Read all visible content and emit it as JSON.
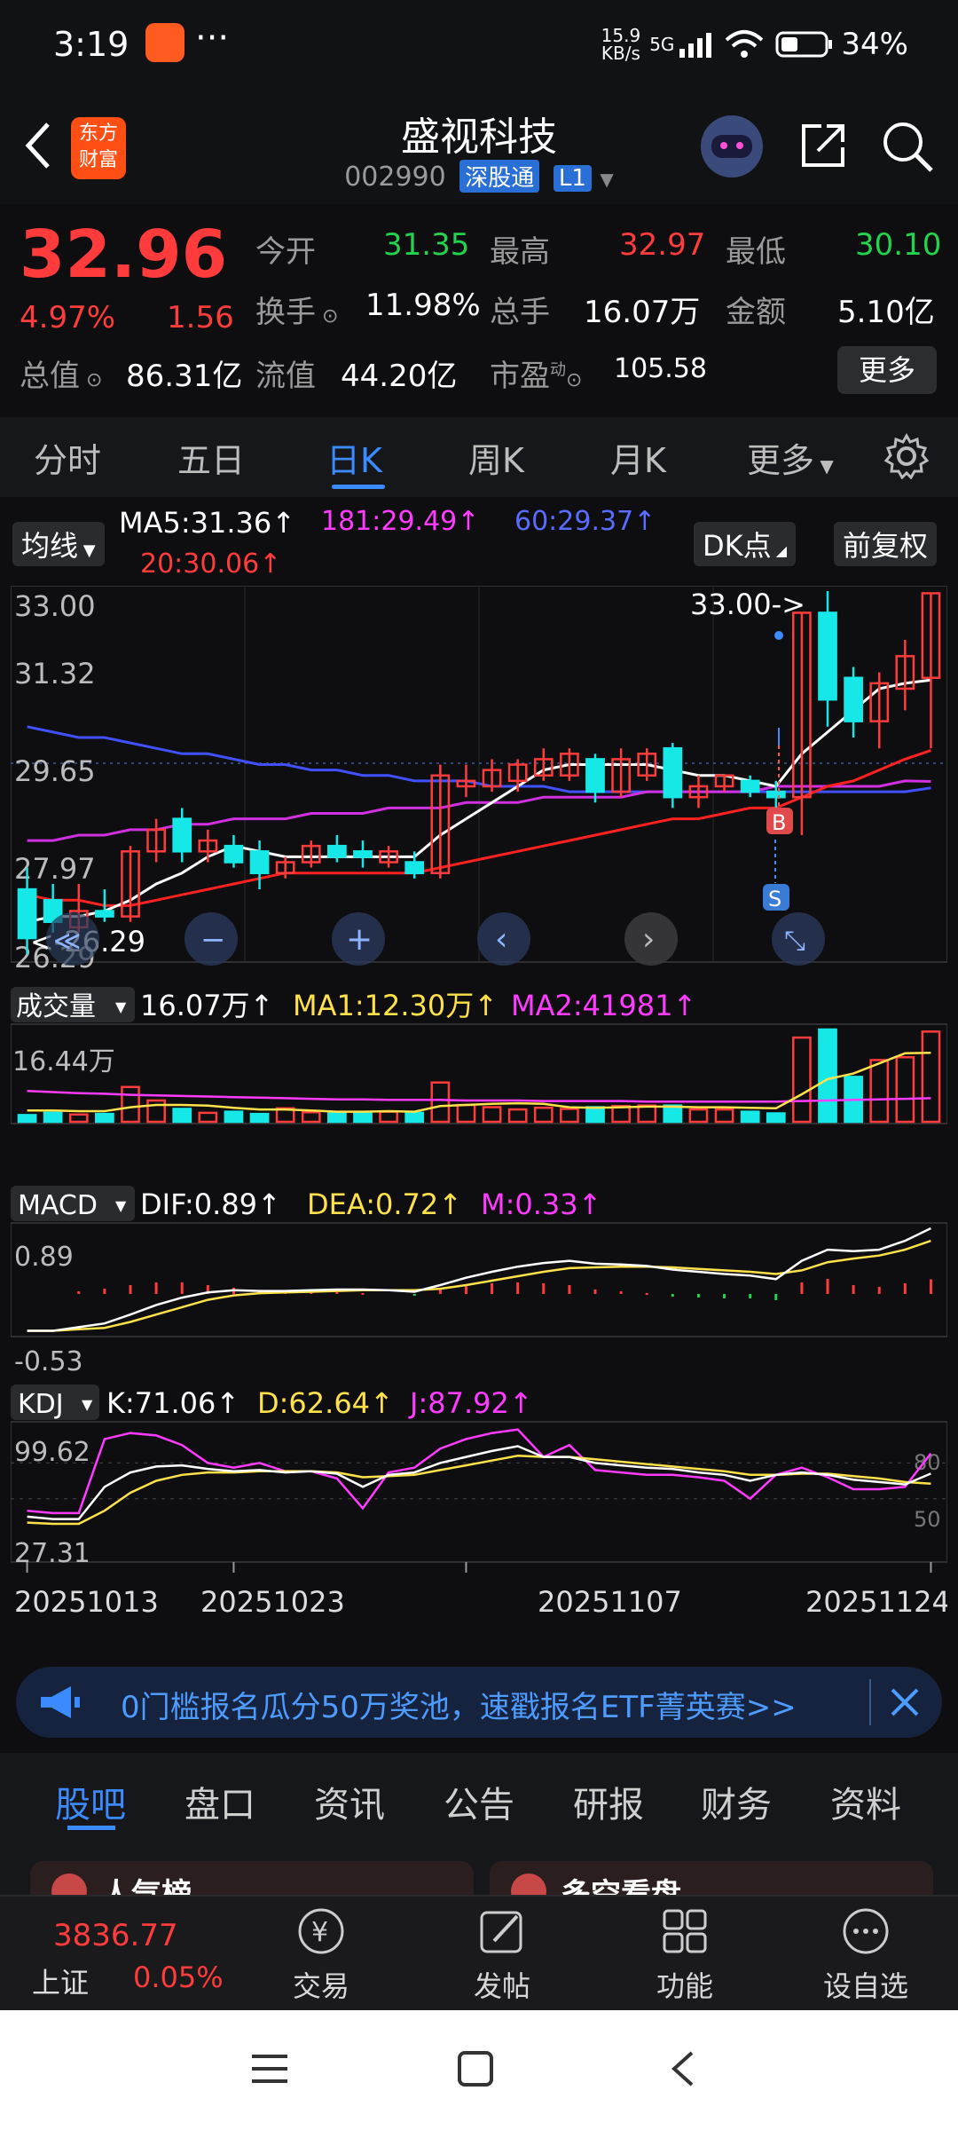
{
  "status_bar": {
    "time": "3:19",
    "net_speed_top": "15.9",
    "net_speed_bottom": "KB/s",
    "signal": "5G",
    "battery": "34%"
  },
  "header": {
    "logo_top": "东方",
    "logo_bottom": "财富",
    "title": "盛视科技",
    "code": "002990",
    "market_tag": "深股通",
    "level_tag": "L1"
  },
  "quote": {
    "price": "32.96",
    "change_pct": "4.97%",
    "change": "1.56",
    "open_label": "今开",
    "open": "31.35",
    "high_label": "最高",
    "high": "32.97",
    "low_label": "最低",
    "low": "30.10",
    "turnover_label": "换手",
    "turnover": "11.98%",
    "volume_label": "总手",
    "volume": "16.07万",
    "amount_label": "金额",
    "amount": "5.10亿",
    "mktcap_label": "总值",
    "mktcap": "86.31亿",
    "float_label": "流值",
    "float": "44.20亿",
    "pe_label": "市盈",
    "pe_sup": "动",
    "pe": "105.58",
    "more_button": "更多"
  },
  "period_tabs": [
    "分时",
    "五日",
    "日K",
    "周K",
    "月K",
    "更多"
  ],
  "active_period": "日K",
  "ma_bar": {
    "chip": "均线",
    "ma5": "MA5:31.36↑",
    "ma181": "181:29.49↑",
    "ma60": "60:29.37↑",
    "ma20": "20:30.06↑",
    "dk_button": "DK点",
    "fq_button": "前复权"
  },
  "colors": {
    "up": "#ff3b3b",
    "down": "#16e8e8",
    "ma5": "#ffffff",
    "ma20": "#ff2020",
    "ma60": "#4050ff",
    "ma181": "#d030e0",
    "accent": "#3b8bff"
  },
  "chart_data": {
    "type": "candlestick",
    "price_axis_labels": [
      "33.00",
      "31.32",
      "29.65",
      "27.97",
      "26.29"
    ],
    "ylim": [
      26.29,
      33.0
    ],
    "max_annotation": "33.00->",
    "min_annotation": "<-26.29",
    "buy_marker": "B",
    "sell_marker": "S",
    "date_labels": [
      "20251013",
      "20251023",
      "20251107",
      "20251124"
    ],
    "candles": [
      {
        "o": 27.5,
        "h": 27.9,
        "c": 26.6,
        "l": 26.3
      },
      {
        "o": 27.3,
        "h": 27.6,
        "c": 26.9,
        "l": 26.7
      },
      {
        "o": 26.8,
        "h": 27.6,
        "c": 27.1,
        "l": 26.7
      },
      {
        "o": 27.1,
        "h": 27.5,
        "c": 27.0,
        "l": 26.9
      },
      {
        "o": 27.0,
        "h": 28.3,
        "c": 28.2,
        "l": 26.9
      },
      {
        "o": 28.2,
        "h": 28.8,
        "c": 28.6,
        "l": 28.0
      },
      {
        "o": 28.8,
        "h": 29.0,
        "c": 28.2,
        "l": 28.0
      },
      {
        "o": 28.2,
        "h": 28.6,
        "c": 28.4,
        "l": 28.0
      },
      {
        "o": 28.3,
        "h": 28.5,
        "c": 28.0,
        "l": 27.9
      },
      {
        "o": 28.2,
        "h": 28.4,
        "c": 27.8,
        "l": 27.5
      },
      {
        "o": 27.8,
        "h": 28.1,
        "c": 28.0,
        "l": 27.7
      },
      {
        "o": 28.0,
        "h": 28.4,
        "c": 28.3,
        "l": 27.9
      },
      {
        "o": 28.3,
        "h": 28.5,
        "c": 28.1,
        "l": 28.0
      },
      {
        "o": 28.2,
        "h": 28.4,
        "c": 28.1,
        "l": 27.9
      },
      {
        "o": 28.0,
        "h": 28.3,
        "c": 28.2,
        "l": 27.9
      },
      {
        "o": 28.0,
        "h": 28.2,
        "c": 27.8,
        "l": 27.7
      },
      {
        "o": 27.8,
        "h": 29.8,
        "c": 29.6,
        "l": 27.7
      },
      {
        "o": 29.4,
        "h": 29.8,
        "c": 29.5,
        "l": 29.2
      },
      {
        "o": 29.4,
        "h": 29.9,
        "c": 29.7,
        "l": 29.3
      },
      {
        "o": 29.5,
        "h": 29.9,
        "c": 29.8,
        "l": 29.3
      },
      {
        "o": 29.6,
        "h": 30.1,
        "c": 29.9,
        "l": 29.5
      },
      {
        "o": 29.6,
        "h": 30.1,
        "c": 30.0,
        "l": 29.5
      },
      {
        "o": 29.9,
        "h": 30.0,
        "c": 29.3,
        "l": 29.1
      },
      {
        "o": 29.3,
        "h": 30.1,
        "c": 29.9,
        "l": 29.2
      },
      {
        "o": 29.6,
        "h": 30.1,
        "c": 30.0,
        "l": 29.5
      },
      {
        "o": 30.1,
        "h": 30.2,
        "c": 29.2,
        "l": 29.0
      },
      {
        "o": 29.2,
        "h": 29.6,
        "c": 29.4,
        "l": 29.0
      },
      {
        "o": 29.4,
        "h": 29.6,
        "c": 29.6,
        "l": 29.3
      },
      {
        "o": 29.5,
        "h": 29.6,
        "c": 29.3,
        "l": 29.2
      },
      {
        "o": 29.3,
        "h": 29.5,
        "c": 29.2,
        "l": 28.8
      },
      {
        "o": 29.2,
        "h": 32.6,
        "c": 32.6,
        "l": 28.5
      },
      {
        "o": 32.6,
        "h": 33.0,
        "c": 31.0,
        "l": 30.5
      },
      {
        "o": 31.4,
        "h": 31.6,
        "c": 30.6,
        "l": 30.3
      },
      {
        "o": 30.6,
        "h": 31.5,
        "c": 31.3,
        "l": 30.1
      },
      {
        "o": 31.2,
        "h": 32.1,
        "c": 31.8,
        "l": 30.8
      },
      {
        "o": 31.4,
        "h": 32.97,
        "c": 32.96,
        "l": 30.1
      }
    ],
    "ma5": [
      26.9,
      27.0,
      27.0,
      27.1,
      27.3,
      27.6,
      27.8,
      28.1,
      28.3,
      28.2,
      28.1,
      28.1,
      28.1,
      28.1,
      28.1,
      28.1,
      28.5,
      28.8,
      29.1,
      29.4,
      29.7,
      29.8,
      29.8,
      29.8,
      29.8,
      29.7,
      29.6,
      29.6,
      29.5,
      29.4,
      30.0,
      30.4,
      30.8,
      31.2,
      31.3,
      31.36
    ],
    "ma20": [
      27.4,
      27.3,
      27.3,
      27.2,
      27.2,
      27.3,
      27.4,
      27.5,
      27.6,
      27.7,
      27.8,
      27.8,
      27.8,
      27.8,
      27.8,
      27.8,
      27.9,
      28.0,
      28.1,
      28.2,
      28.3,
      28.4,
      28.5,
      28.6,
      28.7,
      28.8,
      28.8,
      28.9,
      29.0,
      29.0,
      29.2,
      29.4,
      29.5,
      29.7,
      29.9,
      30.06
    ],
    "ma60": [
      30.5,
      30.4,
      30.3,
      30.3,
      30.2,
      30.1,
      30.0,
      30.0,
      29.9,
      29.8,
      29.8,
      29.7,
      29.7,
      29.6,
      29.6,
      29.5,
      29.5,
      29.5,
      29.4,
      29.4,
      29.4,
      29.3,
      29.3,
      29.3,
      29.3,
      29.3,
      29.3,
      29.3,
      29.3,
      29.3,
      29.3,
      29.3,
      29.3,
      29.3,
      29.3,
      29.37
    ],
    "ma181": [
      28.4,
      28.4,
      28.5,
      28.5,
      28.6,
      28.6,
      28.7,
      28.7,
      28.8,
      28.8,
      28.8,
      28.9,
      28.9,
      28.9,
      29.0,
      29.0,
      29.0,
      29.1,
      29.1,
      29.1,
      29.2,
      29.2,
      29.2,
      29.2,
      29.3,
      29.3,
      29.3,
      29.3,
      29.3,
      29.4,
      29.4,
      29.4,
      29.4,
      29.4,
      29.5,
      29.49
    ],
    "volume": {
      "label": "成交量",
      "value": "16.07万↑",
      "ma1": "MA1:12.30万↑",
      "ma2": "MA2:41981↑",
      "axis_label": "16.44万",
      "max": 16.44,
      "bars": [
        1.2,
        1.6,
        1.3,
        1.4,
        6.2,
        3.8,
        2.3,
        1.6,
        1.8,
        1.4,
        2.4,
        1.7,
        1.5,
        1.7,
        1.8,
        1.6,
        7.0,
        3.0,
        2.6,
        2.2,
        2.5,
        2.3,
        2.6,
        2.8,
        2.9,
        2.9,
        2.2,
        2.2,
        1.8,
        1.5,
        15.0,
        16.44,
        8.0,
        11.0,
        11.5,
        16.07
      ],
      "ma1_line": [
        2.0,
        2.0,
        1.9,
        1.9,
        2.6,
        3.0,
        3.0,
        2.9,
        2.5,
        2.2,
        2.2,
        2.0,
        1.8,
        1.8,
        1.9,
        1.8,
        2.8,
        3.0,
        3.2,
        3.3,
        3.2,
        2.6,
        2.5,
        2.6,
        2.7,
        2.7,
        2.6,
        2.6,
        2.5,
        2.4,
        4.9,
        7.6,
        8.6,
        10.4,
        12.2,
        12.3
      ],
      "ma2_line": [
        5.5,
        5.3,
        5.1,
        5.0,
        4.8,
        4.7,
        4.6,
        4.5,
        4.4,
        4.3,
        4.2,
        4.1,
        4.0,
        4.0,
        3.9,
        3.9,
        3.9,
        3.8,
        3.8,
        3.8,
        3.7,
        3.7,
        3.7,
        3.7,
        3.6,
        3.6,
        3.6,
        3.6,
        3.6,
        3.6,
        3.7,
        3.8,
        3.9,
        4.0,
        4.1,
        4.2
      ]
    },
    "macd": {
      "label": "MACD",
      "dif": "DIF:0.89↑",
      "dea": "DEA:0.72↑",
      "m": "M:0.33↑",
      "axis_top": "0.89",
      "axis_bottom": "-0.53",
      "ylim": [
        -0.53,
        0.89
      ],
      "dif_line": [
        -0.5,
        -0.5,
        -0.45,
        -0.4,
        -0.28,
        -0.15,
        -0.05,
        0.02,
        0.05,
        0.04,
        0.04,
        0.05,
        0.06,
        0.06,
        0.05,
        0.03,
        0.12,
        0.22,
        0.3,
        0.37,
        0.42,
        0.45,
        0.41,
        0.4,
        0.38,
        0.33,
        0.3,
        0.27,
        0.25,
        0.2,
        0.45,
        0.6,
        0.58,
        0.6,
        0.72,
        0.89
      ],
      "dea_line": [
        -0.5,
        -0.5,
        -0.48,
        -0.46,
        -0.38,
        -0.28,
        -0.18,
        -0.08,
        -0.02,
        0.01,
        0.02,
        0.03,
        0.04,
        0.05,
        0.05,
        0.05,
        0.07,
        0.12,
        0.18,
        0.24,
        0.3,
        0.35,
        0.36,
        0.37,
        0.37,
        0.36,
        0.34,
        0.32,
        0.3,
        0.27,
        0.32,
        0.43,
        0.48,
        0.52,
        0.6,
        0.72
      ],
      "m_bars": [
        0.0,
        0.0,
        0.06,
        0.12,
        0.2,
        0.26,
        0.26,
        0.2,
        0.14,
        0.06,
        0.04,
        0.04,
        0.04,
        0.02,
        0.0,
        -0.04,
        0.1,
        0.2,
        0.24,
        0.26,
        0.24,
        0.2,
        0.1,
        0.06,
        0.02,
        -0.06,
        -0.08,
        -0.1,
        -0.1,
        -0.14,
        0.26,
        0.34,
        0.2,
        0.16,
        0.24,
        0.33
      ]
    },
    "kdj": {
      "label": "KDJ",
      "k": "K:71.06↑",
      "d": "D:62.64↑",
      "j": "J:87.92↑",
      "axis_top": "99.62",
      "axis_bottom": "27.31",
      "ref_80": "80",
      "ref_50": "50",
      "ylim": [
        27.31,
        99.62
      ],
      "k_line": [
        35,
        33,
        33,
        60,
        72,
        77,
        78,
        75,
        73,
        74,
        72,
        73,
        71,
        60,
        70,
        72,
        80,
        85,
        90,
        94,
        85,
        85,
        80,
        78,
        76,
        75,
        72,
        70,
        65,
        70,
        72,
        70,
        66,
        64,
        62,
        71.06
      ],
      "d_line": [
        30,
        29,
        29,
        40,
        55,
        65,
        70,
        72,
        72,
        73,
        73,
        73,
        72,
        68,
        69,
        70,
        74,
        78,
        82,
        86,
        85,
        85,
        83,
        81,
        79,
        77,
        75,
        73,
        70,
        70,
        71,
        71,
        69,
        67,
        64,
        62.64
      ],
      "j_line": [
        40,
        38,
        38,
        100,
        105,
        103,
        95,
        80,
        76,
        80,
        73,
        73,
        67,
        42,
        72,
        76,
        92,
        100,
        105,
        108,
        85,
        95,
        74,
        72,
        70,
        70,
        68,
        65,
        50,
        70,
        76,
        68,
        58,
        58,
        60,
        87.92
      ]
    }
  },
  "chart_controls": [
    "≪",
    "−",
    "+",
    "‹",
    "›",
    "⤡"
  ],
  "banner": {
    "text": "0门槛报名瓜分50万奖池，速戳报名ETF菁英赛>>"
  },
  "bottom_tabs": [
    "股吧",
    "盘口",
    "资讯",
    "公告",
    "研报",
    "财务",
    "资料"
  ],
  "active_bottom_tab": "股吧",
  "cards": {
    "left": "人气榜",
    "right": "多空看盘"
  },
  "bottom_nav": {
    "index_value": "3836.77",
    "index_name": "上证",
    "index_change": "0.05%",
    "items": [
      "交易",
      "发帖",
      "功能",
      "设自选"
    ]
  }
}
